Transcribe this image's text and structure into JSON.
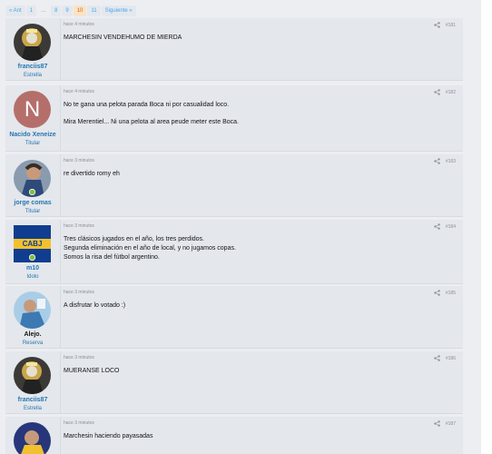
{
  "pagination": {
    "items": [
      {
        "label": "« Ant",
        "kind": "nav"
      },
      {
        "label": "1",
        "kind": "page"
      },
      {
        "label": "…",
        "kind": "gap"
      },
      {
        "label": "8",
        "kind": "page"
      },
      {
        "label": "9",
        "kind": "page"
      },
      {
        "label": "10",
        "kind": "current"
      },
      {
        "label": "11",
        "kind": "page"
      },
      {
        "label": "Siguiente »",
        "kind": "nav"
      }
    ]
  },
  "posts": [
    {
      "username": "franciis87",
      "title": "Estrella",
      "time": "hace 4 minutos",
      "num": "#181",
      "lines": [
        "MARCHESIN VENDEHUMO DE MIERDA"
      ]
    },
    {
      "username": "Nacido Xeneize",
      "title": "Titular",
      "time": "hace 4 minutos",
      "num": "#182",
      "avatar_letter": "N",
      "lines": [
        "No te gana una pelota parada Boca ni por casualidad loco.",
        "Mira Merentiel... Ni una pelota al area peude meter este Boca."
      ]
    },
    {
      "username": "jorge comas",
      "title": "Titular",
      "time": "hace 3 minutos",
      "num": "#183",
      "lines": [
        "re divertido romy eh"
      ]
    },
    {
      "username": "m10",
      "title": "Idolo",
      "time": "hace 3 minutos",
      "num": "#184",
      "avatar_letters": "CABJ",
      "lines": [
        "Tres clásicos jugados en el año, los tres perdidos.",
        "Segunda eliminación en el año de local, y no jugamos copas.",
        "Somos la risa del fútbol argentino."
      ]
    },
    {
      "username": "Alejo.",
      "title": "Reserva",
      "time": "hace 3 minutos",
      "num": "#185",
      "lines": [
        "A disfrutar lo votado :)"
      ]
    },
    {
      "username": "franciis87",
      "title": "Estrella",
      "time": "hace 3 minutos",
      "num": "#186",
      "lines": [
        "MUERANSE LOCO"
      ]
    },
    {
      "username": "",
      "title": "",
      "time": "hace 3 minutos",
      "num": "#187",
      "lines": [
        "Marchesin haciendo payasadas"
      ]
    }
  ],
  "colors": {
    "accent": "#2577b1",
    "current_page_bg": "#fbe3c6",
    "online_badge": "#7fbf3f"
  },
  "icons": {
    "share": "share-icon",
    "online": "online-badge-icon"
  }
}
